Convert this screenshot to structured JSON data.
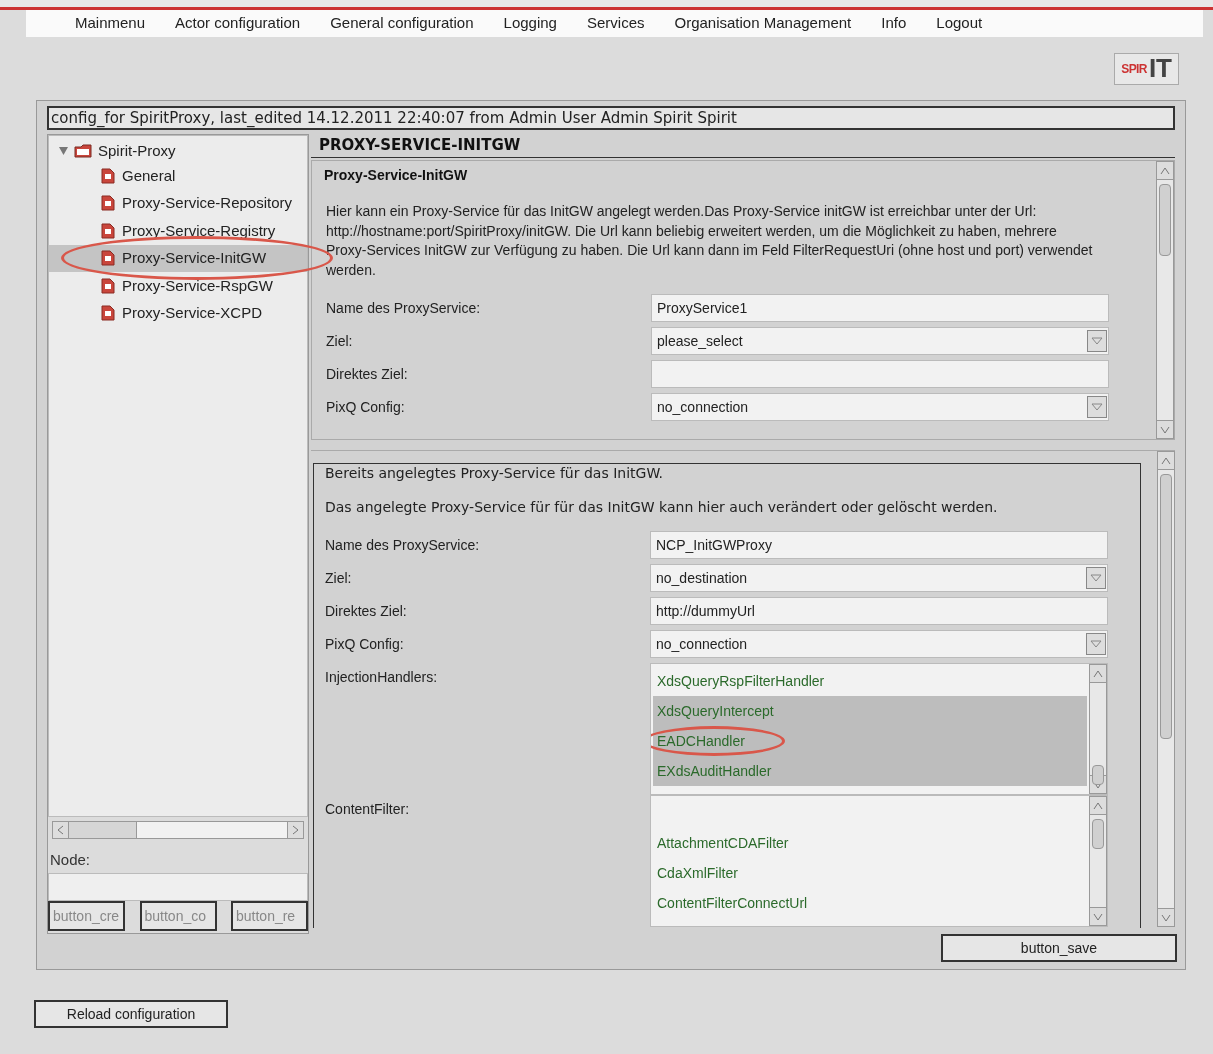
{
  "menu": [
    "Mainmenu",
    "Actor configuration",
    "General configuration",
    "Logging",
    "Services",
    "Organisation Management",
    "Info",
    "Logout"
  ],
  "logo": {
    "part_1": "SPIR",
    "part_2": "IT"
  },
  "config_title": "config_for SpiritProxy, last_edited 14.12.2011 22:40:07 from Admin User Admin Spirit  Spirit",
  "tree": {
    "label": "Spirit-Proxy",
    "expanded": true,
    "children": [
      {
        "label": "General",
        "selected": false,
        "circled": false
      },
      {
        "label": "Proxy-Service-Repository",
        "selected": false,
        "circled": false
      },
      {
        "label": "Proxy-Service-Registry",
        "selected": false,
        "circled": false
      },
      {
        "label": "Proxy-Service-InitGW",
        "selected": true,
        "circled": true
      },
      {
        "label": "Proxy-Service-RspGW",
        "selected": false,
        "circled": false
      },
      {
        "label": "Proxy-Service-XCPD",
        "selected": false,
        "circled": false
      }
    ]
  },
  "node_label": "Node:",
  "tree_buttons": [
    "button_cre",
    "button_co",
    "button_re"
  ],
  "section_title": "PROXY-SERVICE-INITGW",
  "new_service": {
    "heading": "Proxy-Service-InitGW",
    "description": "Hier kann ein Proxy-Service für das InitGW angelegt werden.Das Proxy-Service initGW ist erreichbar unter der Url: http://hostname:port/SpiritProxy/initGW. Die Url kann beliebig erweitert werden, um die Möglichkeit zu haben, mehrere Proxy-Services InitGW zur Verfügung zu haben. Die Url kann dann im Feld FilterRequestUri (ohne host und port) verwendet werden.",
    "fields": [
      {
        "kind": "text",
        "label": "Name des ProxyService:",
        "value": "ProxyService1"
      },
      {
        "kind": "select",
        "label": "Ziel:",
        "value": "please_select"
      },
      {
        "kind": "text",
        "label": "Direktes Ziel:"
      },
      {
        "kind": "select",
        "label": "PixQ Config:",
        "value": "no_connection"
      }
    ]
  },
  "existing_service": {
    "legend": "Bereits angelegtes Proxy-Service für das InitGW.",
    "description": "Das angelegte  Proxy-Service für für das InitGW kann hier auch verändert oder gelöscht werden.",
    "fields": [
      {
        "kind": "text",
        "label": "Name des ProxyService:",
        "value": "NCP_InitGWProxy"
      },
      {
        "kind": "select",
        "label": "Ziel:",
        "value": "no_destination"
      },
      {
        "kind": "text",
        "label": "Direktes Ziel:",
        "value": "http://dummyUrl"
      },
      {
        "kind": "select",
        "label": "PixQ Config:",
        "value": "no_connection"
      },
      {
        "kind": "list",
        "label": "InjectionHandlers:",
        "items": [
          {
            "label": "XdsQueryRspFilterHandler",
            "selected": false,
            "circled": false
          },
          {
            "label": "XdsQueryIntercept",
            "selected": true,
            "circled": false
          },
          {
            "label": "EADCHandler",
            "selected": true,
            "circled": true
          },
          {
            "label": "EXdsAuditHandler",
            "selected": true,
            "circled": false
          }
        ]
      },
      {
        "kind": "list",
        "label": "ContentFilter:",
        "items": [
          {
            "label": "AttachmentCDAFilter",
            "selected": false,
            "circled": false
          },
          {
            "label": "CdaXmlFilter",
            "selected": false,
            "circled": false
          },
          {
            "label": "ContentFilterConnectUrl",
            "selected": false,
            "circled": false
          }
        ]
      }
    ]
  },
  "save_button": "button_save",
  "reload_button": "Reload configuration"
}
